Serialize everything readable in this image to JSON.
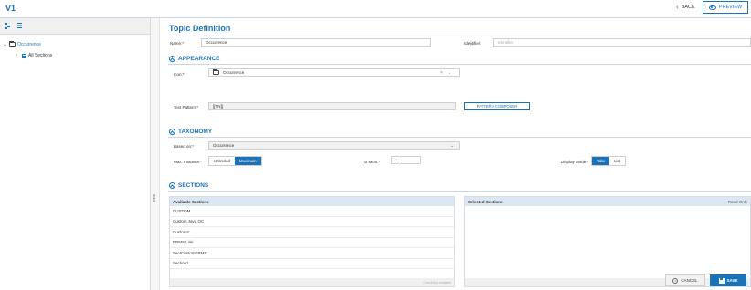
{
  "app": {
    "title": "V1"
  },
  "header": {
    "back_label": "BACK",
    "preview_label": "PREVIEW"
  },
  "tree": {
    "root_label": "Occurrence",
    "child_label": "All Sections"
  },
  "page": {
    "title": "Topic Definition"
  },
  "form": {
    "name_label": "Name:*",
    "name_value": "Occurrence",
    "identifier_label": "Identifier:",
    "identifier_placeholder": "Identifier"
  },
  "appearance": {
    "heading": "APPEARANCE",
    "icon_label": "Icon:*",
    "icon_value": "Occurrence",
    "text_pattern_label": "Text Pattern:*",
    "text_pattern_value": "[[TN]]",
    "pattern_composer_label": "PATTERN COMPOSER"
  },
  "taxonomy": {
    "heading": "TAXONOMY",
    "based_on_label": "Based on:*",
    "based_on_value": "Occurrence",
    "max_instance_label": "Max. Instance:*",
    "max_options": [
      "Unlimited",
      "Maximum"
    ],
    "max_selected": "Maximum",
    "at_most_label": "At Most:*",
    "at_most_value": "1",
    "display_mode_label": "Display Mode:*",
    "display_options": [
      "Tabs",
      "List"
    ],
    "display_selected": "Tabs"
  },
  "sections": {
    "heading": "SECTIONS",
    "available_header": "Available Sections",
    "available_items": [
      "CUSTOM",
      "Custom Java OC",
      "Custom2",
      "ERMS Link",
      "SectCustomERMS",
      "Section1"
    ],
    "available_footer": "0 sections available",
    "selected_header": "Selected Sections",
    "selected_readonly": "Read Only",
    "selected_footer": "0 sections selected"
  },
  "footer": {
    "cancel_label": "CANCEL",
    "save_label": "SAVE"
  },
  "colors": {
    "accent": "#1a73b8",
    "panel_header": "#dbe7f3"
  }
}
